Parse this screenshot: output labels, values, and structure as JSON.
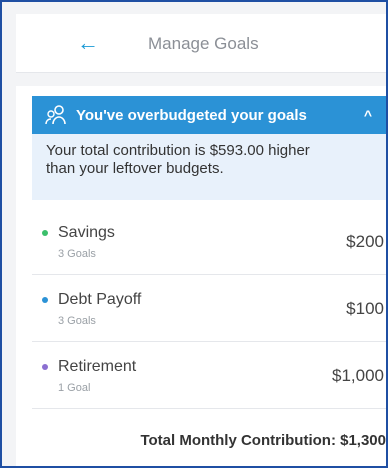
{
  "header": {
    "back_icon": "arrow-left-icon",
    "title": "Manage Goals"
  },
  "alert": {
    "icon": "people-icon",
    "title": "You've overbudgeted your goals",
    "chevron": "^",
    "message_line1": "Your total contribution is $593.00 higher",
    "message_line2": "than your leftover budgets."
  },
  "goals": [
    {
      "name": "Savings",
      "count": "3 Goals",
      "amount": "$200",
      "color": "#3bbf6b"
    },
    {
      "name": "Debt Payoff",
      "count": "3 Goals",
      "amount": "$100",
      "color": "#2b92d6"
    },
    {
      "name": "Retirement",
      "count": "1 Goal",
      "amount": "$1,000",
      "color": "#8b6fd1"
    }
  ],
  "total": {
    "label": "Total Monthly Contribution: $1,300"
  }
}
